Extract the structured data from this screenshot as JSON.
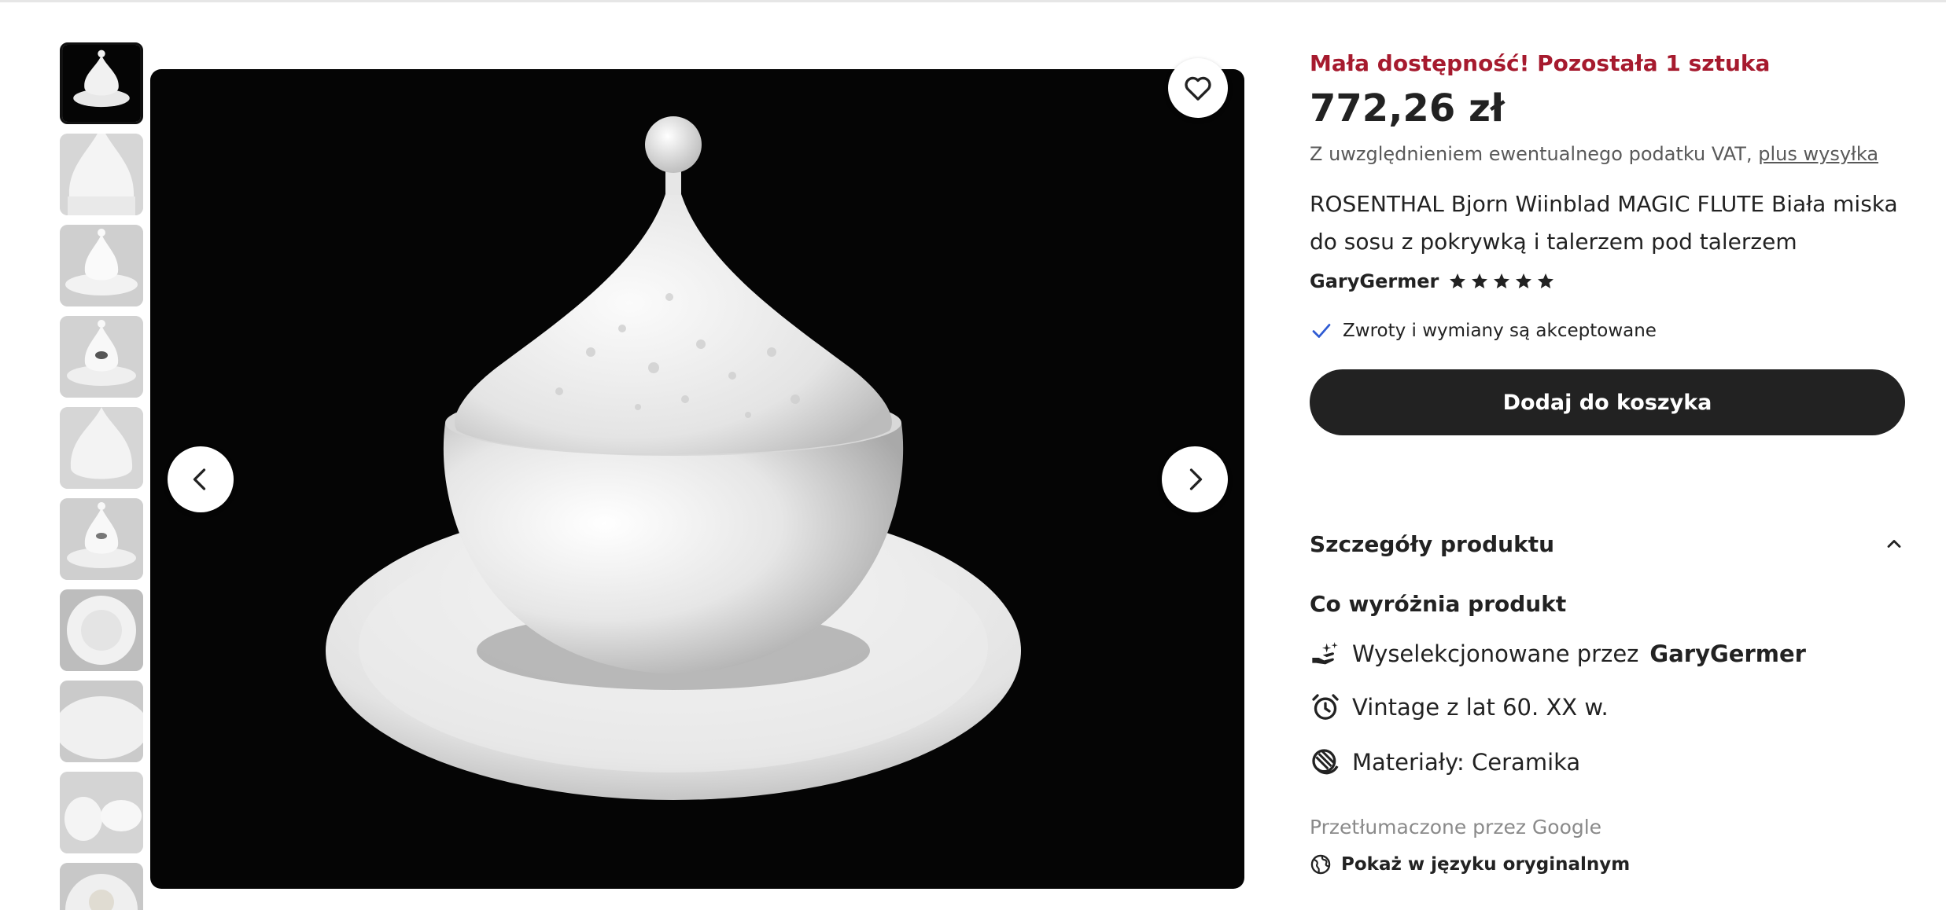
{
  "product": {
    "stock_notice": "Mała dostępność! Pozostała 1 sztuka",
    "price": "772,26 zł",
    "vat_text": "Z uwzględnieniem ewentualnego podatku VAT,",
    "shipping_link": "plus wysyłka",
    "title": "ROSENTHAL Bjorn Wiinblad MAGIC FLUTE Biała miska do sosu z pokrywką i talerzem pod talerzem",
    "seller": "GaryGermer",
    "rating_stars": 5,
    "returns": "Zwroty i wymiany są akceptowane",
    "add_to_cart": "Dodaj do koszyka"
  },
  "details": {
    "header": "Szczegóły produktu",
    "highlights_title": "Co wyróżnia produkt",
    "curated_prefix": "Wyselekcjonowane przez",
    "curated_seller": "GaryGermer",
    "vintage": "Vintage z lat 60. XX w.",
    "materials": "Materiały: Ceramika",
    "translated_by": "Przetłumaczone przez Google",
    "show_original": "Pokaż w języku oryginalnym"
  },
  "gallery": {
    "thumbnail_count": 10,
    "selected_index": 0
  },
  "colors": {
    "stock_red": "#a61a2e",
    "button_dark": "#222222",
    "check_blue": "#2f5bd3"
  },
  "icons": [
    "heart-icon",
    "chevron-left-icon",
    "chevron-right-icon",
    "star-icon",
    "check-icon",
    "chevron-up-icon",
    "hand-sparkle-icon",
    "alarm-clock-icon",
    "material-icon",
    "globe-icon"
  ]
}
